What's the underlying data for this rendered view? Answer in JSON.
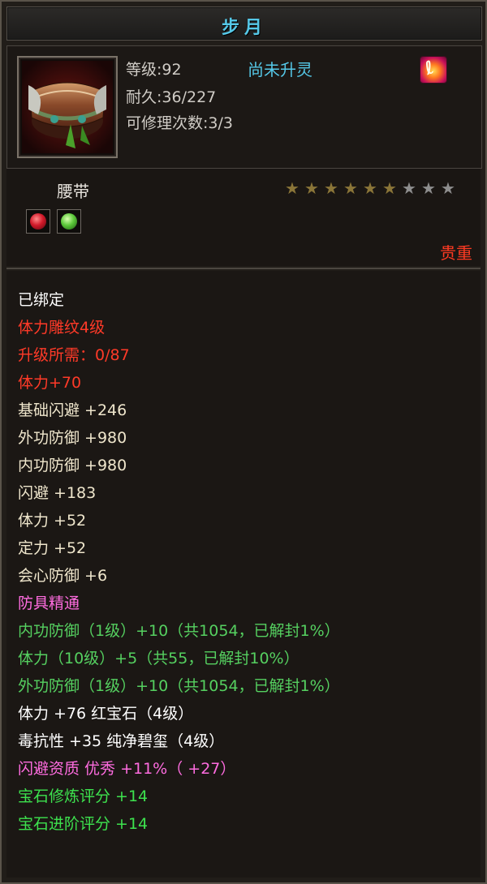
{
  "item": {
    "name": "步月",
    "level": "等级:92",
    "spirit_status": "尚未升灵",
    "durability": "耐久:36/227",
    "repair_count": "可修理次数:3/3",
    "type": "腰带",
    "rarity": "贵重",
    "stars": {
      "filled": 6,
      "total": 9
    }
  },
  "icons": {
    "item_icon": "belt-icon",
    "spirit_icon": "flame-icon",
    "gems": [
      "red-gem-icon",
      "green-gem-icon"
    ]
  },
  "colors": {
    "title": "#55c8e8",
    "rarity": "#ff3a22",
    "bound": "#ffffff",
    "red_attr": "#ff3a28",
    "base_attr": "#efe6cc",
    "mastery": "#ff6ce0",
    "green_attr": "#55d060"
  },
  "attributes": [
    {
      "text": "已绑定",
      "color": "white"
    },
    {
      "text": "体力雕纹4级",
      "color": "red"
    },
    {
      "text": "升级所需：0/87",
      "color": "red"
    },
    {
      "text": "体力+70",
      "color": "red"
    },
    {
      "text": "基础闪避 +246",
      "color": "beige"
    },
    {
      "text": "外功防御 +980",
      "color": "beige"
    },
    {
      "text": "内功防御 +980",
      "color": "beige"
    },
    {
      "text": "闪避 +183",
      "color": "beige"
    },
    {
      "text": "体力 +52",
      "color": "beige"
    },
    {
      "text": "定力 +52",
      "color": "beige"
    },
    {
      "text": "会心防御 +6",
      "color": "beige"
    },
    {
      "text": "防具精通",
      "color": "pink"
    },
    {
      "text": "内功防御（1级）+10（共1054，已解封1%）",
      "color": "green"
    },
    {
      "text": "体力（10级）+5（共55，已解封10%）",
      "color": "green"
    },
    {
      "text": "外功防御（1级）+10（共1054，已解封1%）",
      "color": "green"
    },
    {
      "text": "体力 +76 红宝石（4级）",
      "color": "white"
    },
    {
      "text": "毒抗性 +35 纯净碧玺（4级）",
      "color": "white"
    },
    {
      "text": "闪避资质  优秀 +11%（ +27）",
      "color": "pink"
    },
    {
      "text": "宝石修炼评分 +14",
      "color": "bright-green"
    },
    {
      "text": "宝石进阶评分 +14",
      "color": "bright-green"
    }
  ]
}
